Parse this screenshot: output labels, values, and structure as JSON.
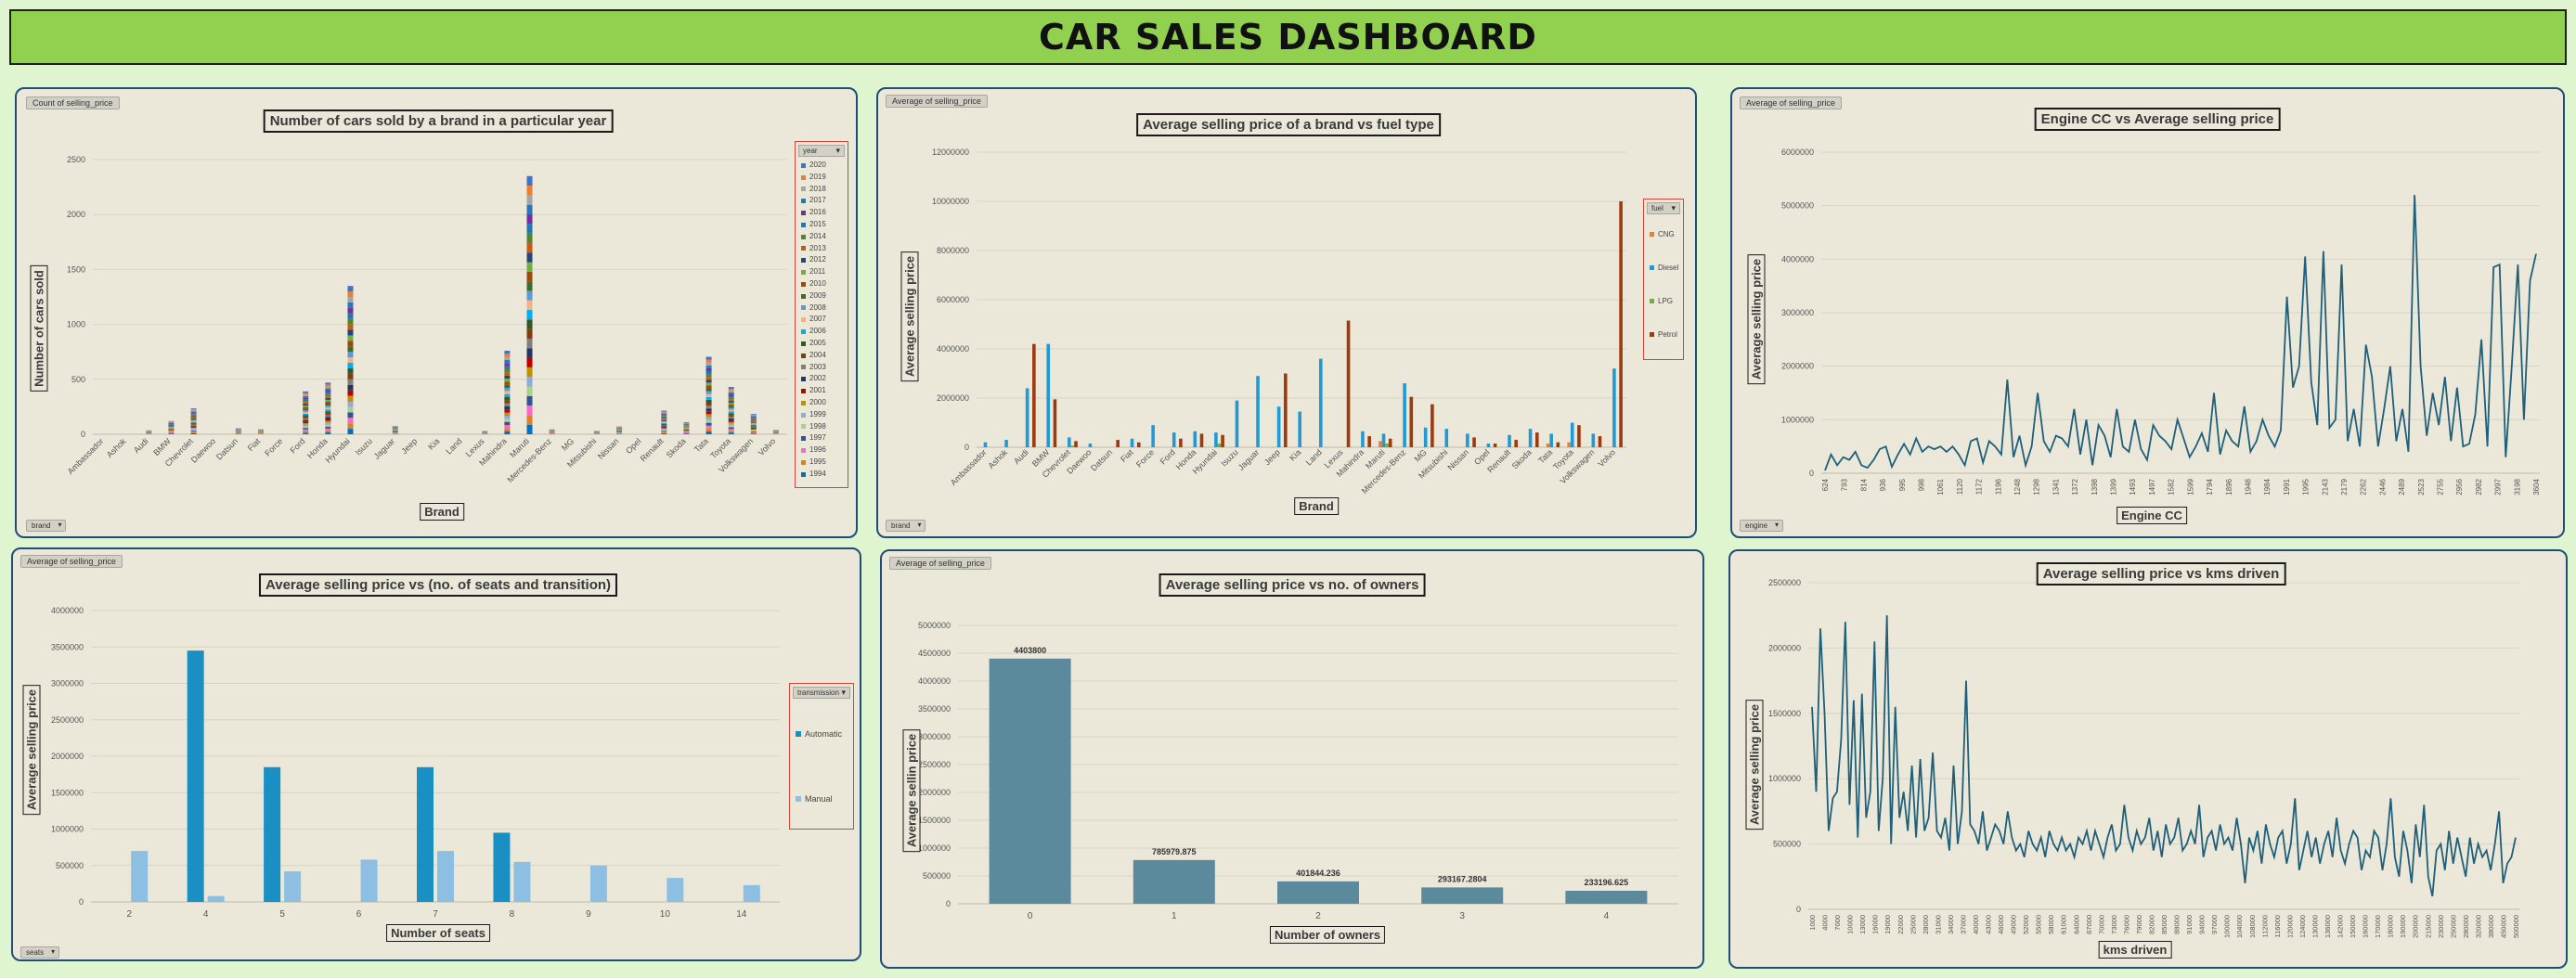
{
  "dashboard_title": "CAR SALES DASHBOARD",
  "chart_data": [
    {
      "id": "brand_year",
      "type": "bar",
      "stacked": true,
      "field_label": "Count of selling_price",
      "title": "Number of cars sold by a brand in a particular year",
      "xlabel": "Brand",
      "ylabel": "Number of cars sold",
      "ylim": [
        0,
        2500
      ],
      "yticks": [
        0,
        500,
        1000,
        1500,
        2000,
        2500
      ],
      "filter_label": "brand",
      "legend_title": "year",
      "legend": [
        "2020",
        "2019",
        "2018",
        "2017",
        "2016",
        "2015",
        "2014",
        "2013",
        "2012",
        "2011",
        "2010",
        "2009",
        "2008",
        "2007",
        "2006",
        "2005",
        "2004",
        "2003",
        "2002",
        "2001",
        "2000",
        "1999",
        "1998",
        "1997",
        "1996",
        "1995",
        "1994"
      ],
      "legend_colors": [
        "#4472c4",
        "#ed7d31",
        "#a5a5a5",
        "#2e75b6",
        "#7030a0",
        "#1f77b4",
        "#548235",
        "#c55a11",
        "#264478",
        "#70ad47",
        "#9e480e",
        "#43682b",
        "#5b9bd5",
        "#f4b183",
        "#00b0f0",
        "#375623",
        "#843c0c",
        "#7f7f7f",
        "#203864",
        "#c00000",
        "#bf9000",
        "#8faadc",
        "#a9d18e",
        "#2f5597",
        "#ff66cc",
        "#d9822b",
        "#0070c0"
      ],
      "categories": [
        "Ambassador",
        "Ashok",
        "Audi",
        "BMW",
        "Chevrolet",
        "Daewoo",
        "Datsun",
        "Fiat",
        "Force",
        "Ford",
        "Honda",
        "Hyundai",
        "Isuzu",
        "Jaguar",
        "Jeep",
        "Kia",
        "Land",
        "Lexus",
        "Mahindra",
        "Maruti",
        "Mercedes-Benz",
        "MG",
        "Mitsubishi",
        "Nissan",
        "Opel",
        "Renault",
        "Skoda",
        "Tata",
        "Toyota",
        "Volkswagen",
        "Volvo"
      ],
      "values": [
        5,
        2,
        35,
        120,
        235,
        4,
        55,
        45,
        8,
        390,
        470,
        1350,
        10,
        75,
        20,
        15,
        8,
        30,
        760,
        2350,
        45,
        15,
        30,
        70,
        3,
        215,
        110,
        705,
        430,
        185,
        40
      ]
    },
    {
      "id": "brand_fuel",
      "type": "bar",
      "field_label": "Average of selling_price",
      "title": "Average selling price of a brand vs fuel type",
      "xlabel": "Brand",
      "ylabel": "Average selling price",
      "ylim": [
        0,
        12000000
      ],
      "yticks": [
        0,
        2000000,
        4000000,
        6000000,
        8000000,
        10000000,
        12000000
      ],
      "filter_label": "brand",
      "legend_title": "fuel",
      "categories": [
        "Ambassador",
        "Ashok",
        "Audi",
        "BMW",
        "Chevrolet",
        "Daewoo",
        "Datsun",
        "Fiat",
        "Force",
        "Ford",
        "Honda",
        "Hyundai",
        "Isuzu",
        "Jaguar",
        "Jeep",
        "Kia",
        "Land",
        "Lexus",
        "Mahindra",
        "Maruti",
        "Mercedes-Benz",
        "MG",
        "Mitsubishi",
        "Nissan",
        "Opel",
        "Renault",
        "Skoda",
        "Tata",
        "Toyota",
        "Volkswagen",
        "Volvo"
      ],
      "series": [
        {
          "name": "CNG",
          "color": "#ed7d31",
          "values": [
            0,
            0,
            0,
            0,
            0,
            0,
            0,
            0,
            0,
            0,
            0,
            0,
            0,
            0,
            0,
            0,
            0,
            0,
            0,
            250000,
            0,
            0,
            0,
            0,
            0,
            0,
            0,
            150000,
            200000,
            0,
            0
          ]
        },
        {
          "name": "Diesel",
          "color": "#1f9ad6",
          "values": [
            200000,
            300000,
            2400000,
            4200000,
            400000,
            150000,
            0,
            350000,
            900000,
            600000,
            650000,
            600000,
            1900000,
            2900000,
            1650000,
            1450000,
            3600000,
            0,
            650000,
            550000,
            2600000,
            800000,
            750000,
            550000,
            150000,
            500000,
            750000,
            550000,
            1000000,
            550000,
            3200000
          ]
        },
        {
          "name": "LPG",
          "color": "#70ad47",
          "values": [
            0,
            0,
            0,
            0,
            60000,
            0,
            0,
            0,
            0,
            0,
            0,
            150000,
            0,
            0,
            0,
            0,
            0,
            0,
            0,
            150000,
            0,
            0,
            0,
            0,
            0,
            0,
            0,
            0,
            0,
            0,
            0
          ]
        },
        {
          "name": "Petrol",
          "color": "#9e3a0e",
          "values": [
            0,
            0,
            4200000,
            1950000,
            250000,
            0,
            300000,
            200000,
            0,
            350000,
            550000,
            500000,
            0,
            0,
            3000000,
            0,
            0,
            5150000,
            450000,
            350000,
            2050000,
            1750000,
            0,
            400000,
            150000,
            300000,
            600000,
            200000,
            900000,
            450000,
            10000000
          ]
        }
      ]
    },
    {
      "id": "engine_cc",
      "type": "line",
      "field_label": "Average of selling_price",
      "title": "Engine CC vs Average selling price",
      "xlabel": "Engine CC",
      "ylabel": "Average selling price",
      "ylim": [
        0,
        6000000
      ],
      "yticks": [
        0,
        1000000,
        2000000,
        3000000,
        4000000,
        5000000,
        6000000
      ],
      "filter_label": "engine",
      "xtick_labels": [
        "624",
        "793",
        "814",
        "936",
        "995",
        "998",
        "1061",
        "1120",
        "1172",
        "1196",
        "1248",
        "1298",
        "1341",
        "1372",
        "1398",
        "1399",
        "1493",
        "1497",
        "1582",
        "1599",
        "1794",
        "1896",
        "1948",
        "1984",
        "1991",
        "1995",
        "2143",
        "2179",
        "2262",
        "2446",
        "2489",
        "2523",
        "2755",
        "2956",
        "2982",
        "2997",
        "3198",
        "3604"
      ],
      "values": [
        50000,
        350000,
        150000,
        300000,
        250000,
        400000,
        150000,
        100000,
        250000,
        450000,
        500000,
        120000,
        350000,
        550000,
        350000,
        650000,
        400000,
        500000,
        450000,
        500000,
        400000,
        500000,
        350000,
        150000,
        600000,
        650000,
        200000,
        600000,
        500000,
        350000,
        1750000,
        300000,
        700000,
        150000,
        500000,
        1500000,
        600000,
        400000,
        700000,
        650000,
        500000,
        1200000,
        350000,
        1000000,
        150000,
        900000,
        700000,
        300000,
        1200000,
        500000,
        400000,
        1000000,
        450000,
        250000,
        900000,
        700000,
        600000,
        450000,
        1000000,
        650000,
        300000,
        500000,
        750000,
        400000,
        1500000,
        350000,
        800000,
        600000,
        500000,
        1250000,
        400000,
        600000,
        1000000,
        700000,
        500000,
        800000,
        3300000,
        1600000,
        2000000,
        4050000,
        1700000,
        900000,
        4150000,
        850000,
        1000000,
        3900000,
        600000,
        1200000,
        500000,
        2400000,
        1800000,
        500000,
        1200000,
        2000000,
        600000,
        1200000,
        400000,
        5200000,
        2000000,
        700000,
        1500000,
        900000,
        1800000,
        600000,
        1600000,
        500000,
        550000,
        1100000,
        2500000,
        500000,
        3850000,
        3900000,
        300000,
        2000000,
        3900000,
        1000000,
        3600000,
        4100000
      ]
    },
    {
      "id": "seats_trans",
      "type": "bar",
      "field_label": "Average of selling_price",
      "title": "Average selling price vs (no. of seats and transition)",
      "xlabel": "Number of seats",
      "ylabel": "Average selling price",
      "ylim": [
        0,
        4000000
      ],
      "yticks": [
        0,
        500000,
        1000000,
        1500000,
        2000000,
        2500000,
        3000000,
        3500000,
        4000000
      ],
      "filter_label": "seats",
      "legend_title": "transmission",
      "categories": [
        "2",
        "4",
        "5",
        "6",
        "7",
        "8",
        "9",
        "10",
        "14"
      ],
      "series": [
        {
          "name": "Automatic",
          "color": "#1a8fc4",
          "values": [
            0,
            3450000,
            1850000,
            0,
            1850000,
            950000,
            0,
            0,
            0
          ]
        },
        {
          "name": "Manual",
          "color": "#8dbfe3",
          "values": [
            700000,
            80000,
            420000,
            580000,
            700000,
            550000,
            500000,
            330000,
            230000
          ]
        }
      ]
    },
    {
      "id": "owners",
      "type": "bar",
      "field_label": "Average of selling_price",
      "title": "Average selling price vs no. of owners",
      "xlabel": "Number of owners",
      "ylabel": "Average sellin price",
      "ylim": [
        0,
        5000000
      ],
      "yticks": [
        0,
        500000,
        1000000,
        1500000,
        2000000,
        2500000,
        3000000,
        3500000,
        4000000,
        4500000,
        5000000
      ],
      "categories": [
        "0",
        "1",
        "2",
        "3",
        "4"
      ],
      "values": [
        4403800,
        785979.875,
        401844.236,
        293167.2804,
        233196.625
      ],
      "data_labels": [
        "4403800",
        "785979.875",
        "401844.236",
        "293167.2804",
        "233196.625"
      ],
      "color": "#5a8a9c"
    },
    {
      "id": "kms",
      "type": "line",
      "title": "Average selling price vs  kms driven",
      "xlabel": "kms driven",
      "ylabel": "Average selling price",
      "ylim": [
        0,
        2500000
      ],
      "yticks": [
        0,
        500000,
        1000000,
        1500000,
        2000000,
        2500000
      ],
      "xtick_labels": [
        "1000",
        "4000",
        "7000",
        "10000",
        "13000",
        "16000",
        "19000",
        "22000",
        "25000",
        "28000",
        "31000",
        "34000",
        "37000",
        "40000",
        "43000",
        "46000",
        "49000",
        "52000",
        "55000",
        "58000",
        "61000",
        "64000",
        "67000",
        "70000",
        "73000",
        "76000",
        "79000",
        "82000",
        "85000",
        "88000",
        "91000",
        "94000",
        "97000",
        "100000",
        "104000",
        "108000",
        "112000",
        "116000",
        "120000",
        "124000",
        "130000",
        "136000",
        "142000",
        "150000",
        "160000",
        "170000",
        "180000",
        "190000",
        "200000",
        "215000",
        "230000",
        "250000",
        "280000",
        "320000",
        "380000",
        "450000",
        "500000"
      ],
      "values": [
        1550000,
        900000,
        2150000,
        1500000,
        600000,
        850000,
        900000,
        1300000,
        2200000,
        800000,
        1600000,
        550000,
        1650000,
        700000,
        900000,
        2050000,
        600000,
        1000000,
        2250000,
        500000,
        1550000,
        700000,
        900000,
        600000,
        1100000,
        550000,
        1150000,
        600000,
        700000,
        1200000,
        600000,
        550000,
        700000,
        450000,
        1100000,
        500000,
        750000,
        1750000,
        650000,
        600000,
        500000,
        750000,
        450000,
        550000,
        650000,
        600000,
        500000,
        750000,
        550000,
        450000,
        500000,
        400000,
        600000,
        500000,
        450000,
        550000,
        400000,
        600000,
        500000,
        450000,
        550000,
        450000,
        500000,
        400000,
        550000,
        500000,
        600000,
        450000,
        600000,
        500000,
        400000,
        550000,
        650000,
        450000,
        500000,
        800000,
        550000,
        450000,
        600000,
        500000,
        550000,
        700000,
        450000,
        600000,
        400000,
        650000,
        500000,
        550000,
        700000,
        450000,
        500000,
        600000,
        500000,
        800000,
        400000,
        550000,
        600000,
        450000,
        650000,
        500000,
        550000,
        450000,
        700000,
        500000,
        200000,
        550000,
        450000,
        600000,
        350000,
        650000,
        500000,
        400000,
        550000,
        600000,
        350000,
        500000,
        850000,
        300000,
        450000,
        600000,
        400000,
        550000,
        350000,
        500000,
        600000,
        400000,
        700000,
        450000,
        350000,
        500000,
        600000,
        550000,
        300000,
        450000,
        400000,
        600000,
        550000,
        300000,
        500000,
        850000,
        400000,
        250000,
        600000,
        450000,
        200000,
        650000,
        400000,
        800000,
        250000,
        100000,
        450000,
        500000,
        300000,
        600000,
        350000,
        550000,
        400000,
        250000,
        550000,
        350000,
        500000,
        400000,
        450000,
        300000,
        500000,
        750000,
        200000,
        350000,
        400000,
        550000
      ]
    }
  ]
}
